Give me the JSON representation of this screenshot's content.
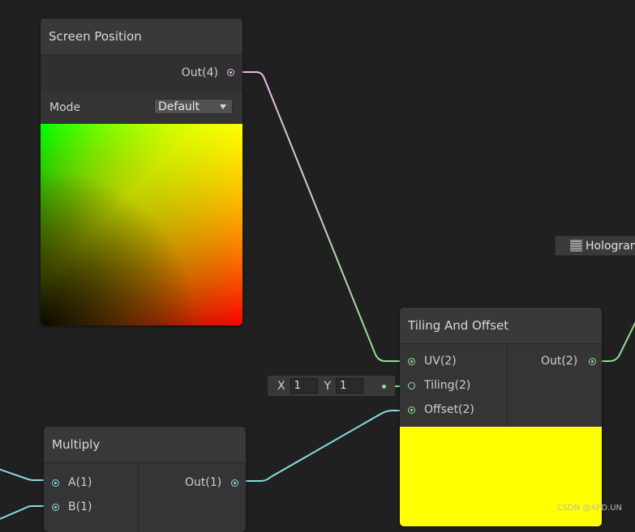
{
  "colors": {
    "canvas_bg": "#202020",
    "node_bg": "#353535",
    "wire_vec2": "#8fe08f",
    "wire_vec1": "#84dce0",
    "wire_vec4": "#e9bde8",
    "tiling_preview": "#ffff00"
  },
  "screen_position_node": {
    "title": "Screen Position",
    "output_label": "Out(4)",
    "mode_label": "Mode",
    "mode_value": "Default",
    "icons": [
      "chevron-down-icon"
    ]
  },
  "tiling_offset_node": {
    "title": "Tiling And Offset",
    "inputs": [
      "UV(2)",
      "Tiling(2)",
      "Offset(2)"
    ],
    "output_label": "Out(2)"
  },
  "tiling_vector_field": {
    "x_label": "X",
    "x_value": "1",
    "y_label": "Y",
    "y_value": "1"
  },
  "multiply_node": {
    "title": "Multiply",
    "inputs": [
      "A(1)",
      "B(1)"
    ],
    "output_label": "Out(1)"
  },
  "hologram_property": {
    "label": "Hologram",
    "icon": "property-icon"
  },
  "watermark": "CSDN @XPD.UN"
}
